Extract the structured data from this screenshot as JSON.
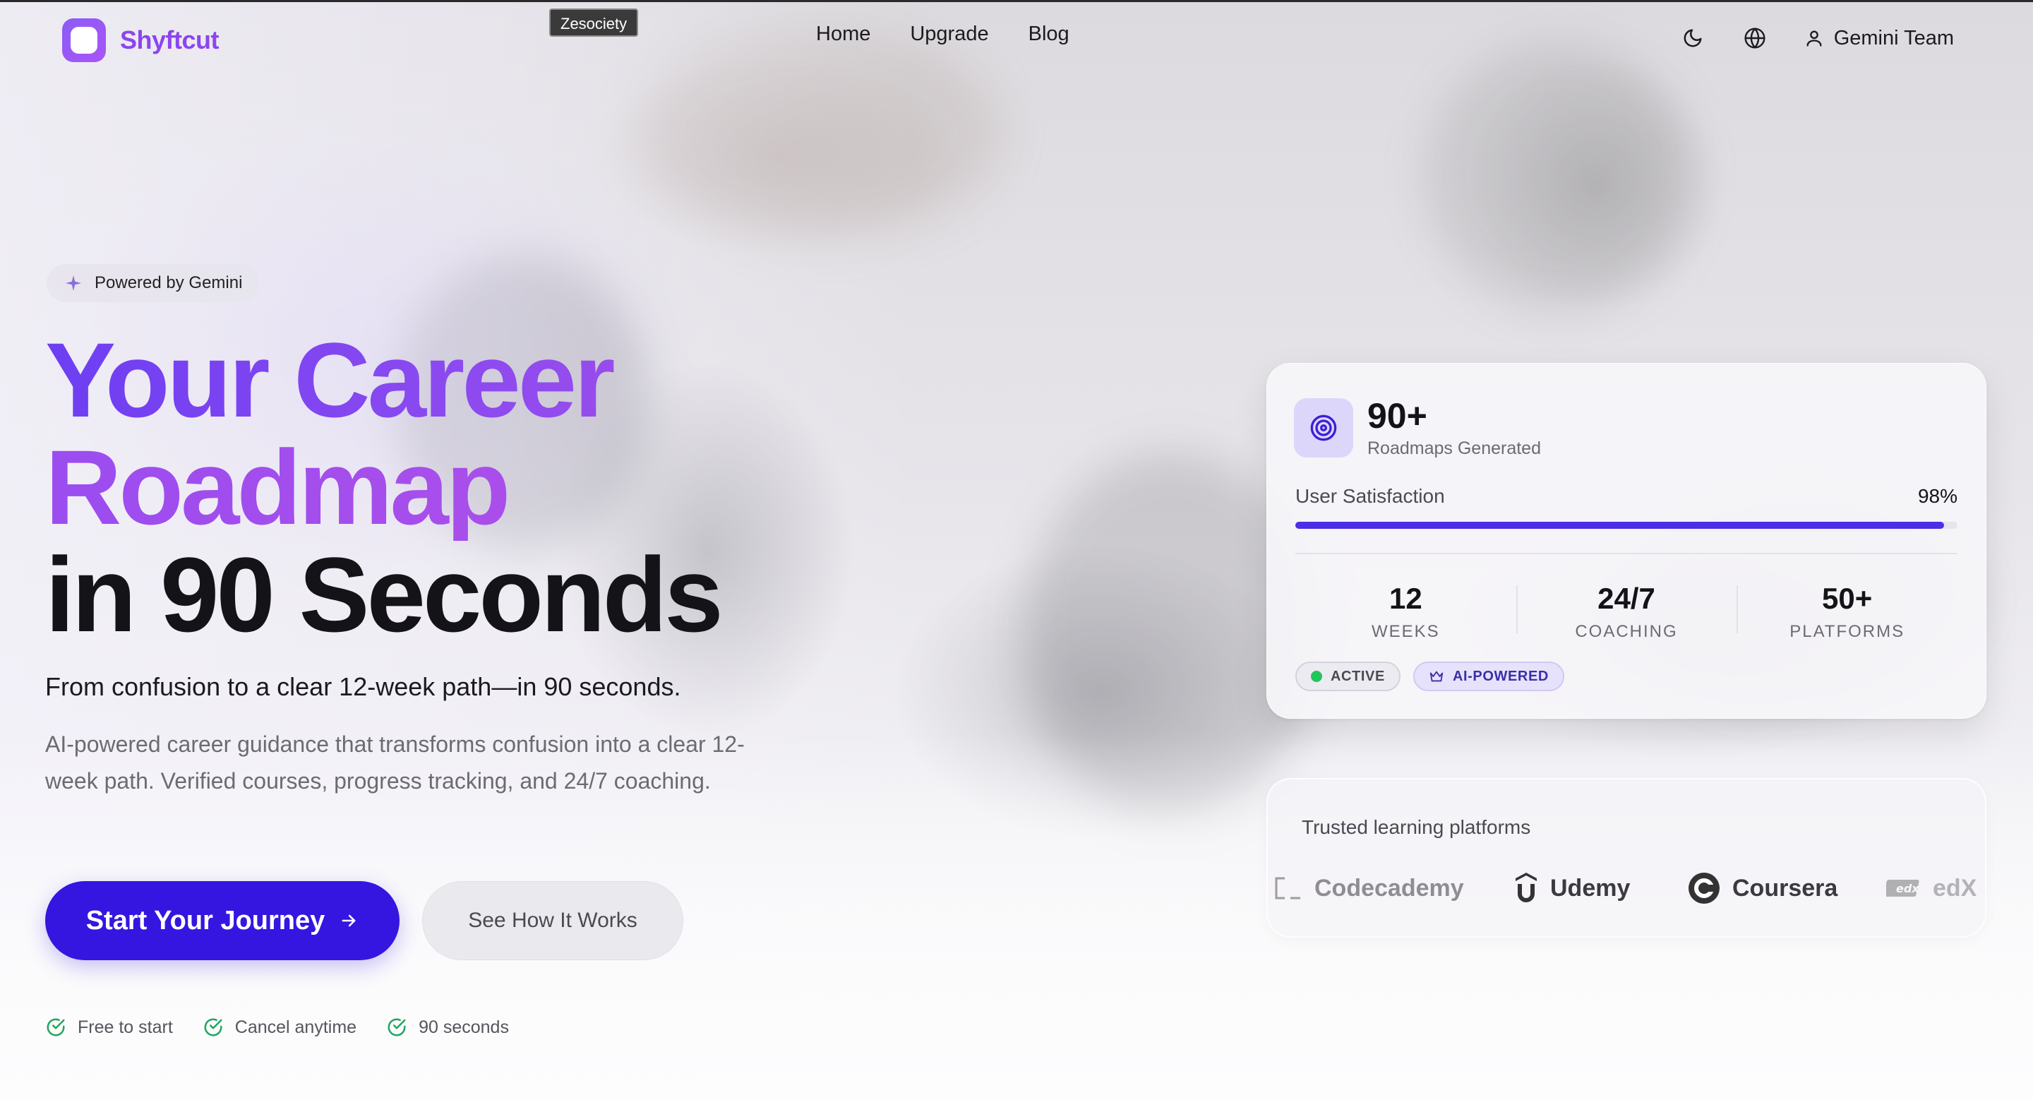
{
  "colors": {
    "brand": "#8b45f0",
    "primary_button": "#3416e0",
    "progress": "#4b2ee6",
    "check": "#22a55e"
  },
  "nav": {
    "brand": "Shyftcut",
    "tooltip": "Zesociety",
    "links": [
      "Home",
      "Upgrade",
      "Blog"
    ],
    "user": "Gemini Team",
    "icons": [
      "moon-icon",
      "globe-icon",
      "user-icon"
    ]
  },
  "hero": {
    "badge": "Powered by Gemini",
    "title_line1": "Your Career",
    "title_line2": "Roadmap",
    "title_line3": "in 90 Seconds",
    "subhead": "From confusion to a clear 12-week path—in 90 seconds.",
    "description": "AI-powered career guidance that transforms confusion into a clear 12-week path. Verified courses, progress tracking, and 24/7 coaching.",
    "cta_primary": "Start Your Journey",
    "cta_secondary": "See How It Works",
    "checks": [
      "Free to start",
      "Cancel anytime",
      "90 seconds"
    ]
  },
  "stats": {
    "count": "90+",
    "count_label": "Roadmaps Generated",
    "satisfaction_label": "User Satisfaction",
    "satisfaction_value": "98%",
    "satisfaction_fraction": 0.98,
    "metrics": [
      {
        "value": "12",
        "label": "WEEKS"
      },
      {
        "value": "24/7",
        "label": "COACHING"
      },
      {
        "value": "50+",
        "label": "PLATFORMS"
      }
    ],
    "tags": [
      "ACTIVE",
      "AI-POWERED"
    ]
  },
  "platforms": {
    "title": "Trusted learning platforms",
    "items": [
      "Codecademy",
      "Udemy",
      "Coursera",
      "edX"
    ]
  }
}
